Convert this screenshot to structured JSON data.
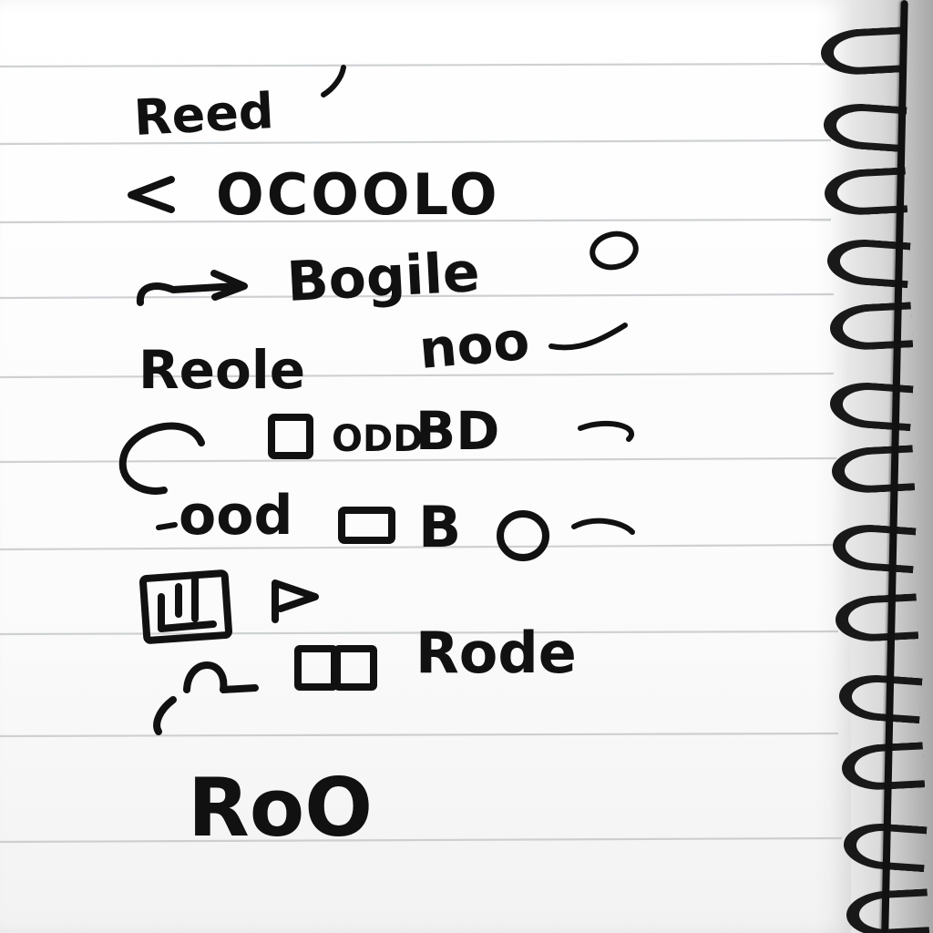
{
  "handwritten_lines": [
    "Reed",
    "OCOOLO",
    "Bogile",
    "Reole",
    "noo",
    "ODD",
    "BD",
    "ood",
    "B",
    "Rode",
    "RoO"
  ]
}
